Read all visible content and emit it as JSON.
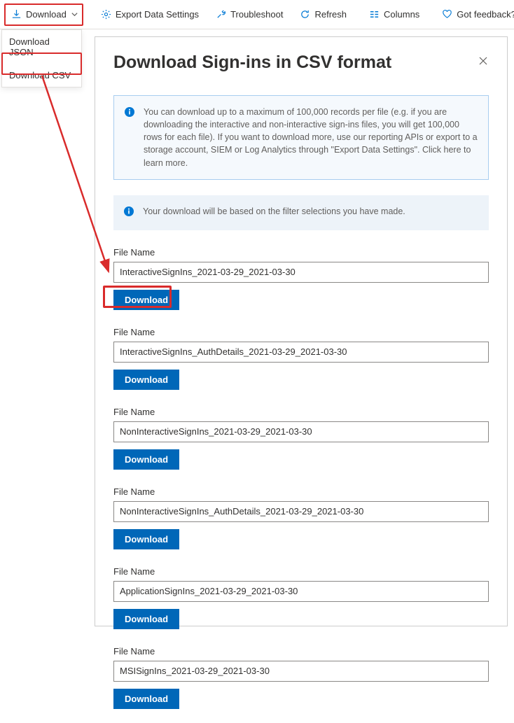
{
  "toolbar": {
    "download": "Download",
    "export": "Export Data Settings",
    "troubleshoot": "Troubleshoot",
    "refresh": "Refresh",
    "columns": "Columns",
    "feedback": "Got feedback?"
  },
  "dropdown": {
    "json": "Download JSON",
    "csv": "Download CSV"
  },
  "panel": {
    "title": "Download Sign-ins in CSV format",
    "info1": "You can download up to a maximum of 100,000 records per file (e.g. if you are downloading the interactive and non-interactive sign-ins files, you will get 100,000 rows for each file).  If you want to download more, use our reporting APIs or export to a storage account, SIEM or Log Analytics through \"Export Data Settings\". Click here to learn more.",
    "info2": "Your download will be based on the filter selections you have made.",
    "file_label": "File Name",
    "download_label": "Download",
    "files": [
      "InteractiveSignIns_2021-03-29_2021-03-30",
      "InteractiveSignIns_AuthDetails_2021-03-29_2021-03-30",
      "NonInteractiveSignIns_2021-03-29_2021-03-30",
      "NonInteractiveSignIns_AuthDetails_2021-03-29_2021-03-30",
      "ApplicationSignIns_2021-03-29_2021-03-30",
      "MSISignIns_2021-03-29_2021-03-30"
    ]
  }
}
